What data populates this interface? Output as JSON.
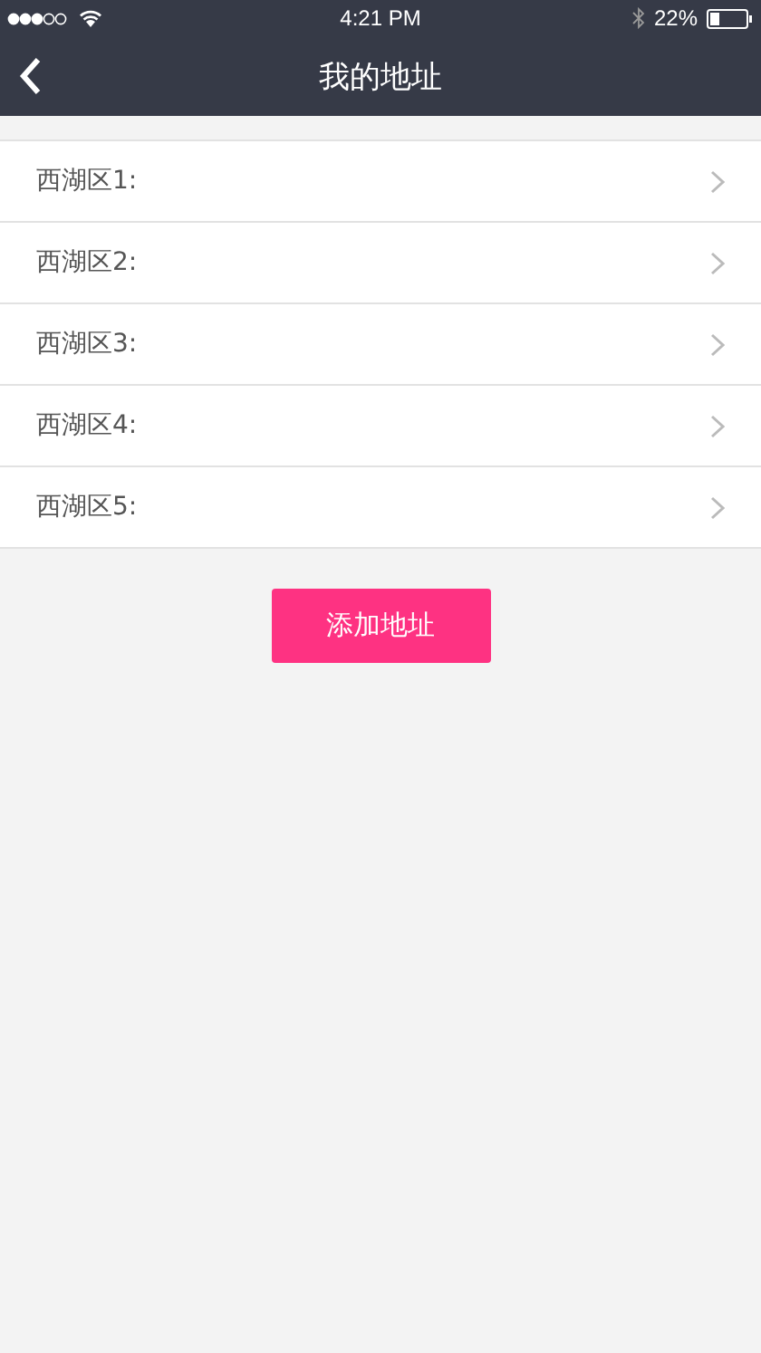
{
  "status_bar": {
    "time": "4:21 PM",
    "battery": "22%"
  },
  "nav": {
    "title": "我的地址"
  },
  "addresses": [
    {
      "label": "西湖区1:"
    },
    {
      "label": "西湖区2:"
    },
    {
      "label": "西湖区3:"
    },
    {
      "label": "西湖区4:"
    },
    {
      "label": "西湖区5:"
    }
  ],
  "add_button": "添加地址"
}
